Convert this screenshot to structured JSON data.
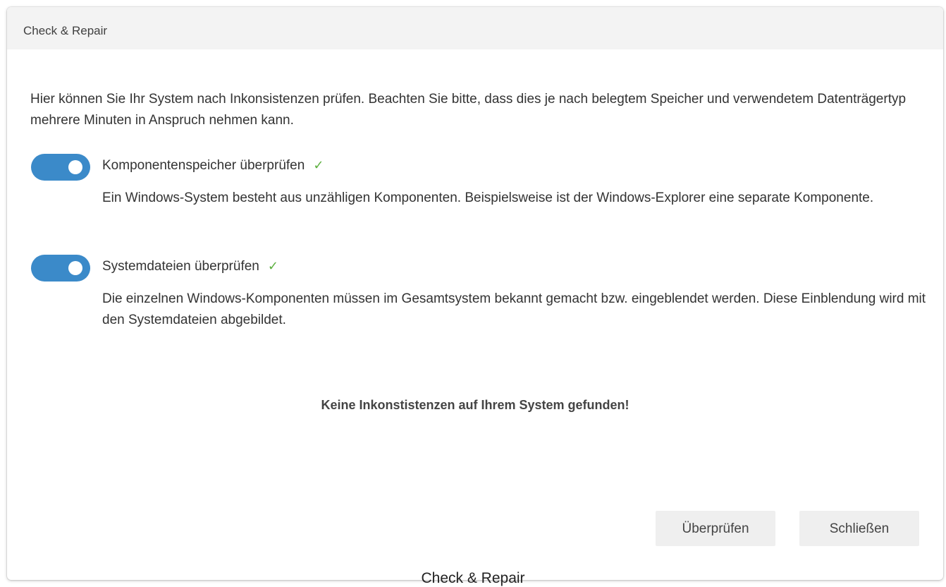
{
  "window": {
    "title": "Check & Repair"
  },
  "intro_text": "Hier können Sie Ihr System nach Inkonsistenzen prüfen. Beachten Sie bitte, dass dies je nach belegtem Speicher und verwendetem Datenträgertyp mehrere Minuten in Anspruch nehmen kann.",
  "options": [
    {
      "title": "Komponentenspeicher überprüfen",
      "checkmark": "✓",
      "description": "Ein Windows-System besteht aus unzähligen Komponenten. Beispielsweise ist der Windows-Explorer eine separate Komponente.",
      "enabled": true
    },
    {
      "title": "Systemdateien überprüfen",
      "checkmark": "✓",
      "description": "Die einzelnen Windows-Komponenten müssen im Gesamtsystem bekannt gemacht bzw. eingeblendet werden. Diese Einblendung wird mit den Systemdateien abgebildet.",
      "enabled": true
    }
  ],
  "status_text": "Keine Inkonstistenzen auf Ihrem System gefunden!",
  "buttons": {
    "check_label": "Überprüfen",
    "close_label": "Schließen"
  },
  "caption": "Check & Repair",
  "colors": {
    "toggle_on": "#3b8ac9",
    "checkmark": "#5db040",
    "titlebar_bg": "#f3f3f3",
    "button_bg": "#efefef"
  }
}
